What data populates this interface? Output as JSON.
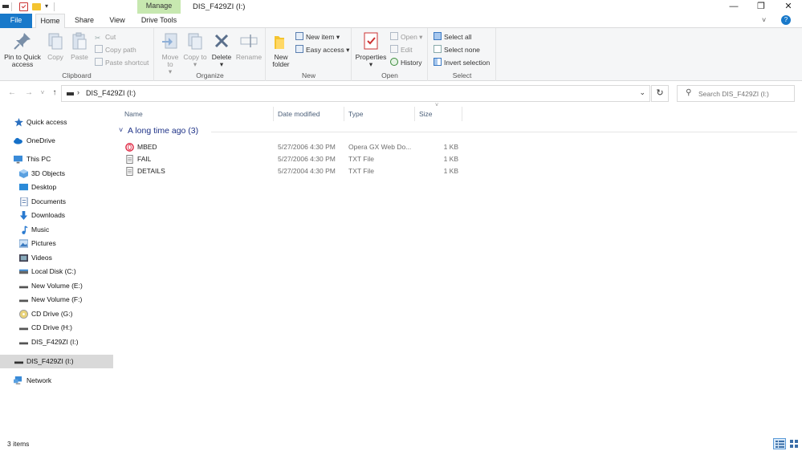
{
  "window": {
    "title": "DIS_F429ZI (I:)",
    "context_tab": "Manage",
    "minimize": "—",
    "maximize": "❐",
    "close": "✕"
  },
  "tabs": [
    "File",
    "Home",
    "Share",
    "View",
    "Drive Tools"
  ],
  "ribbon": {
    "clipboard": {
      "label": "Clipboard",
      "pin": "Pin to Quick access",
      "copy": "Copy",
      "paste": "Paste",
      "cut": "Cut",
      "copy_path": "Copy path",
      "paste_shortcut": "Paste shortcut"
    },
    "organize": {
      "label": "Organize",
      "move_to": "Move to",
      "copy_to": "Copy to",
      "delete": "Delete",
      "rename": "Rename"
    },
    "new": {
      "label": "New",
      "new_folder": "New folder",
      "new_item": "New item",
      "easy_access": "Easy access"
    },
    "open": {
      "label": "Open",
      "properties": "Properties",
      "open": "Open",
      "edit": "Edit",
      "history": "History"
    },
    "select": {
      "label": "Select",
      "select_all": "Select all",
      "select_none": "Select none",
      "invert_selection": "Invert selection"
    }
  },
  "address": {
    "path": "DIS_F429ZI (I:)",
    "search_placeholder": "Search DIS_F429ZI (I:)"
  },
  "nav": [
    {
      "label": "Quick access",
      "icon": "star-icon"
    },
    {
      "label": "OneDrive",
      "icon": "cloud-icon"
    },
    {
      "label": "This PC",
      "icon": "computer-icon"
    },
    {
      "label": "3D Objects",
      "icon": "cube-icon"
    },
    {
      "label": "Desktop",
      "icon": "desktop-icon"
    },
    {
      "label": "Documents",
      "icon": "document-icon"
    },
    {
      "label": "Downloads",
      "icon": "download-icon"
    },
    {
      "label": "Music",
      "icon": "music-icon"
    },
    {
      "label": "Pictures",
      "icon": "picture-icon"
    },
    {
      "label": "Videos",
      "icon": "video-icon"
    },
    {
      "label": "Local Disk (C:)",
      "icon": "drive-icon"
    },
    {
      "label": "New Volume (E:)",
      "icon": "drive-icon"
    },
    {
      "label": "New Volume (F:)",
      "icon": "drive-icon"
    },
    {
      "label": "CD Drive (G:)",
      "icon": "cd-icon"
    },
    {
      "label": "CD Drive (H:)",
      "icon": "drive-icon"
    },
    {
      "label": "DIS_F429ZI (I:)",
      "icon": "drive-icon"
    },
    {
      "label": "DIS_F429ZI (I:)",
      "icon": "drive-icon"
    },
    {
      "label": "Network",
      "icon": "network-icon"
    }
  ],
  "columns": [
    "Name",
    "Date modified",
    "Type",
    "Size"
  ],
  "group": "A long time ago (3)",
  "files": [
    {
      "name": "MBED",
      "date": "5/27/2006 4:30 PM",
      "type": "Opera GX Web Do...",
      "size": "1 KB",
      "icon": "opera-icon"
    },
    {
      "name": "FAIL",
      "date": "5/27/2006 4:30 PM",
      "type": "TXT File",
      "size": "1 KB",
      "icon": "text-file-icon"
    },
    {
      "name": "DETAILS",
      "date": "5/27/2004 4:30 PM",
      "type": "TXT File",
      "size": "1 KB",
      "icon": "text-file-icon"
    }
  ],
  "status": "3 items",
  "colors": {
    "accent": "#1979ca",
    "context_tab": "#c7e8b0",
    "group_header": "#1e3287"
  }
}
